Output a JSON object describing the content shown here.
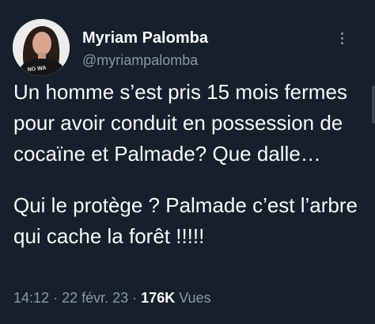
{
  "tweet": {
    "author_name": "Myriam Palomba",
    "author_handle": "@myriampalomba",
    "avatar_shirt_text": "NO WA",
    "paragraphs": [
      "Un homme s’est pris 15 mois fermes pour avoir conduit en possession de cocaïne et Palmade? Que dalle…",
      "Qui le protège ? Palmade c’est l’arbre qui cache la forêt !!!!!"
    ],
    "time": "14:12",
    "date": "22 févr. 23",
    "separator": "·",
    "views_count": "176K",
    "views_label": "Vues",
    "more_icon": "more-horizontal-icon"
  },
  "colors": {
    "background": "#15202b",
    "text": "#f7f9f9",
    "secondary": "#8b98a5"
  }
}
